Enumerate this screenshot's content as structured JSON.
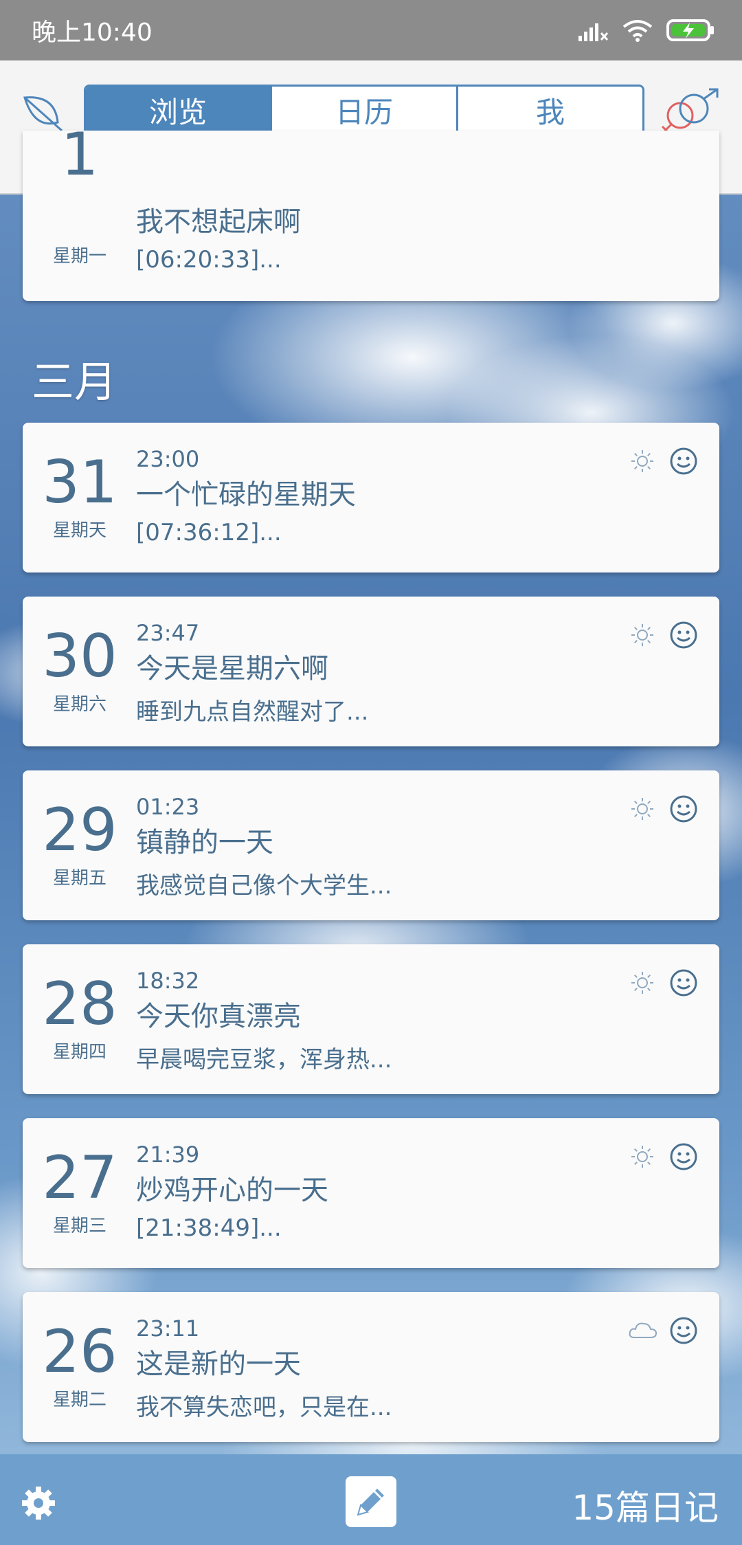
{
  "status_bar": {
    "time": "晚上10:40",
    "battery": "charging"
  },
  "header": {
    "tabs": [
      {
        "label": "浏览",
        "active": true
      },
      {
        "label": "日历",
        "active": false
      },
      {
        "label": "我",
        "active": false
      }
    ],
    "left_icon": "leaf-icon",
    "right_icon": "gender-icon"
  },
  "partial_entry": {
    "day": "1",
    "weekday": "星期一",
    "title": "我不想起床啊",
    "preview": "[06:20:33]..."
  },
  "month_label": "三月",
  "entries": [
    {
      "day": "31",
      "weekday": "星期天",
      "time": "23:00",
      "title": "一个忙碌的星期天",
      "preview": "[07:36:12]...",
      "weather": "sun-icon",
      "mood": "smile-icon"
    },
    {
      "day": "30",
      "weekday": "星期六",
      "time": "23:47",
      "title": "今天是星期六啊",
      "preview": "睡到九点自然醒对了...",
      "weather": "sun-icon",
      "mood": "smile-icon"
    },
    {
      "day": "29",
      "weekday": "星期五",
      "time": "01:23",
      "title": "镇静的一天",
      "preview": "我感觉自己像个大学生...",
      "weather": "sun-icon",
      "mood": "smile-icon"
    },
    {
      "day": "28",
      "weekday": "星期四",
      "time": "18:32",
      "title": "今天你真漂亮",
      "preview": "早晨喝完豆浆，浑身热...",
      "weather": "sun-icon",
      "mood": "smile-icon"
    },
    {
      "day": "27",
      "weekday": "星期三",
      "time": "21:39",
      "title": "炒鸡开心的一天",
      "preview": "[21:38:49]...",
      "weather": "sun-icon",
      "mood": "smile-icon"
    },
    {
      "day": "26",
      "weekday": "星期二",
      "time": "23:11",
      "title": "这是新的一天",
      "preview": "我不算失恋吧，只是在...",
      "weather": "cloud-icon",
      "mood": "smile-icon"
    }
  ],
  "bottom_bar": {
    "count_label": "15篇日记"
  },
  "colors": {
    "accent": "#4d86bb",
    "text": "#4a6f8e",
    "bottom_bar": "#6fa0cd"
  }
}
